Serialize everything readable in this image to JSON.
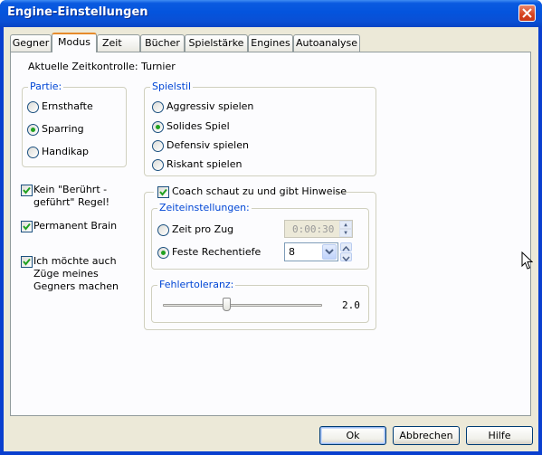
{
  "window": {
    "title": "Engine-Einstellungen"
  },
  "tabs": [
    {
      "label": "Gegner"
    },
    {
      "label": "Modus"
    },
    {
      "label": "Zeit"
    },
    {
      "label": "Bücher"
    },
    {
      "label": "Spielstärke"
    },
    {
      "label": "Engines"
    },
    {
      "label": "Autoanalyse"
    }
  ],
  "active_tab": "Modus",
  "current_time_control": "Aktuelle Zeitkontrolle: Turnier",
  "partie": {
    "legend": "Partie:",
    "options": [
      {
        "label": "Ernsthafte",
        "selected": false
      },
      {
        "label": "Sparring",
        "selected": true
      },
      {
        "label": "Handikap",
        "selected": false
      }
    ]
  },
  "spielstil": {
    "legend": "Spielstil",
    "options": [
      {
        "label": "Aggressiv spielen",
        "selected": false
      },
      {
        "label": "Solides Spiel",
        "selected": true
      },
      {
        "label": "Defensiv spielen",
        "selected": false
      },
      {
        "label": "Riskant spielen",
        "selected": false
      }
    ]
  },
  "checkboxes": {
    "touch_move": {
      "label_line1": "Kein \"Berührt -",
      "label_line2": "geführt\" Regel!",
      "checked": true
    },
    "permanent_brain": {
      "label": "Permanent Brain",
      "checked": true
    },
    "opponent_moves": {
      "label_line1": "Ich möchte auch",
      "label_line2": "Züge meines",
      "label_line3": "Gegners machen",
      "checked": true
    }
  },
  "coach": {
    "label": "Coach schaut zu und gibt Hinweise",
    "checked": true,
    "time_settings": {
      "legend": "Zeiteinstellungen:",
      "time_per_move": {
        "label": "Zeit pro Zug",
        "selected": false,
        "value": "0:00:30",
        "disabled": true
      },
      "fixed_depth": {
        "label": "Feste Rechentiefe",
        "selected": true,
        "value": "8"
      }
    },
    "error_tolerance": {
      "legend": "Fehlertoleranz:",
      "value_label": "2.0",
      "slider_fraction": 0.4
    }
  },
  "buttons": {
    "ok": "Ok",
    "cancel": "Abbrechen",
    "help": "Hilfe"
  },
  "colors": {
    "title_bar": "#0a5ae0",
    "group_legend": "#0046d5",
    "radio_dot": "#21a121",
    "tab_active_accent": "#e68b2c"
  }
}
